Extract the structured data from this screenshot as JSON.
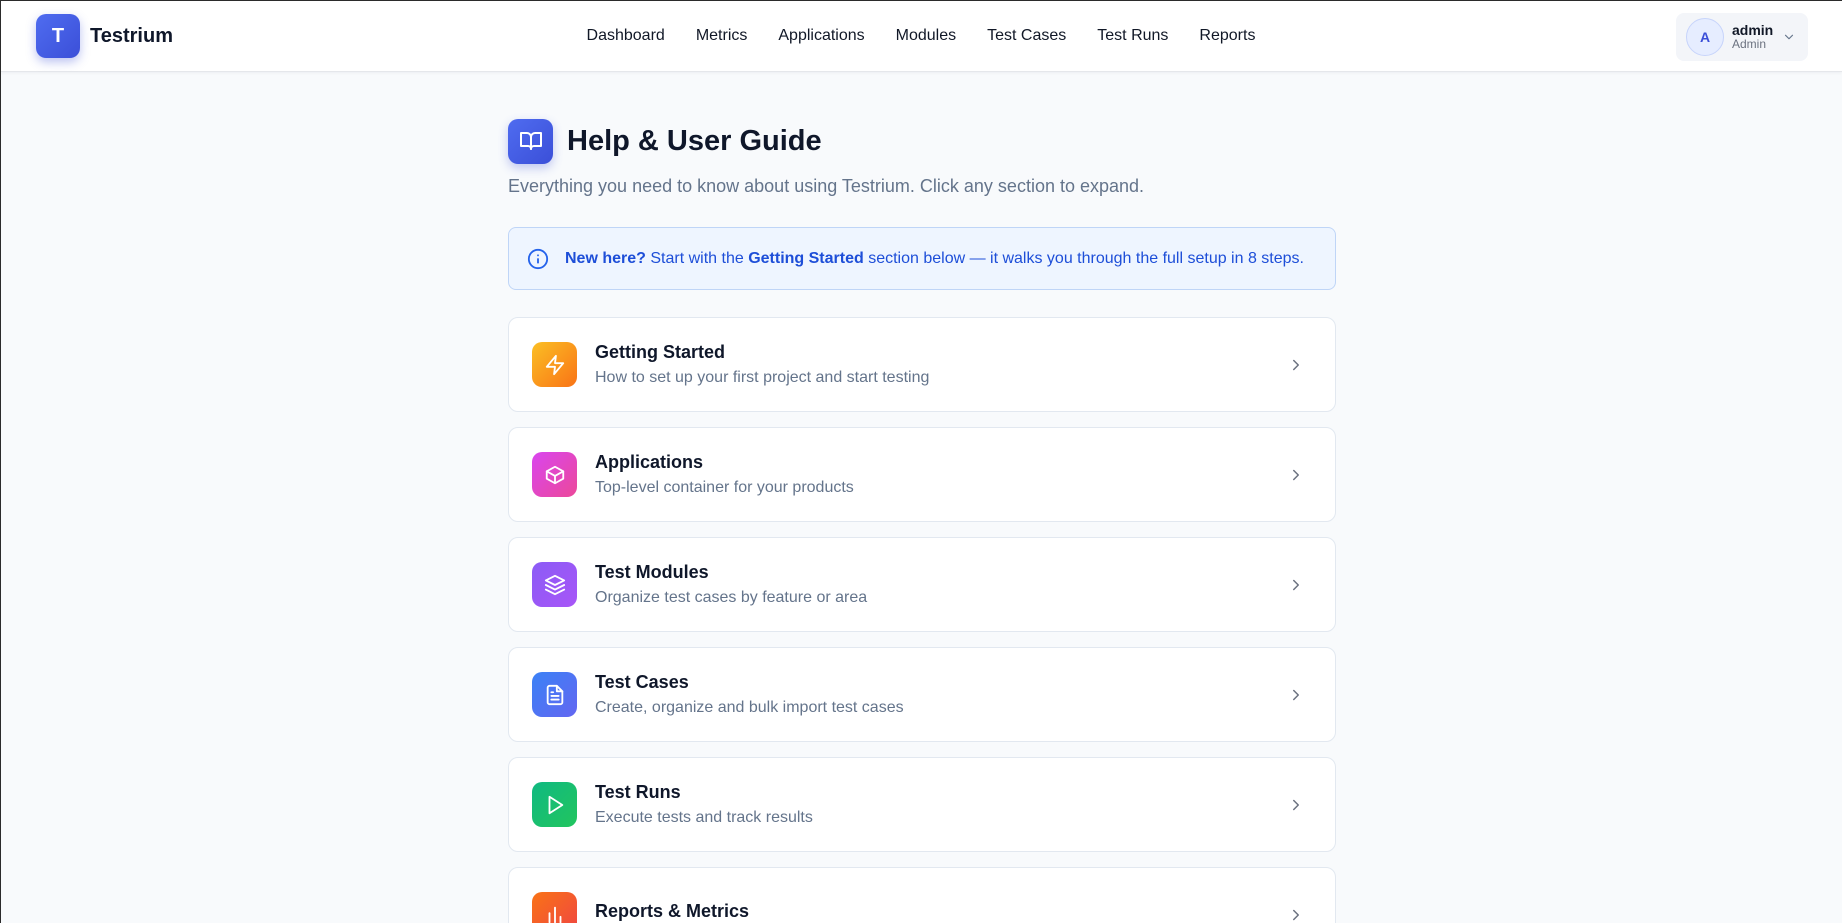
{
  "app": {
    "logo_letter": "T",
    "name": "Testrium"
  },
  "nav": {
    "items": [
      {
        "label": "Dashboard"
      },
      {
        "label": "Metrics"
      },
      {
        "label": "Applications"
      },
      {
        "label": "Modules"
      },
      {
        "label": "Test Cases"
      },
      {
        "label": "Test Runs"
      },
      {
        "label": "Reports"
      }
    ]
  },
  "user": {
    "initial": "A",
    "name": "admin",
    "role": "Admin"
  },
  "page": {
    "title": "Help & User Guide",
    "subtitle": "Everything you need to know about using Testrium. Click any section to expand.",
    "icon": "book-open-icon"
  },
  "info_banner": {
    "lead": "New here?",
    "text_before": " Start with the ",
    "highlight": "Getting Started",
    "text_after": " section below — it walks you through the full setup in 8 steps.",
    "color": "#1d4ed8"
  },
  "sections": [
    {
      "title": "Getting Started",
      "description": "How to set up your first project and start testing",
      "icon": "zap-icon",
      "color_from": "#fbbf24",
      "color_to": "#f97316"
    },
    {
      "title": "Applications",
      "description": "Top-level container for your products",
      "icon": "box-icon",
      "color_from": "#d946ef",
      "color_to": "#ec4899"
    },
    {
      "title": "Test Modules",
      "description": "Organize test cases by feature or area",
      "icon": "layers-icon",
      "color_from": "#8b5cf6",
      "color_to": "#a855f7"
    },
    {
      "title": "Test Cases",
      "description": "Create, organize and bulk import test cases",
      "icon": "file-text-icon",
      "color_from": "#3b82f6",
      "color_to": "#6366f1"
    },
    {
      "title": "Test Runs",
      "description": "Execute tests and track results",
      "icon": "play-icon",
      "color_from": "#10b981",
      "color_to": "#22c55e"
    },
    {
      "title": "Reports & Metrics",
      "description": "",
      "icon": "bar-chart-icon",
      "color_from": "#f97316",
      "color_to": "#ef4444"
    }
  ]
}
